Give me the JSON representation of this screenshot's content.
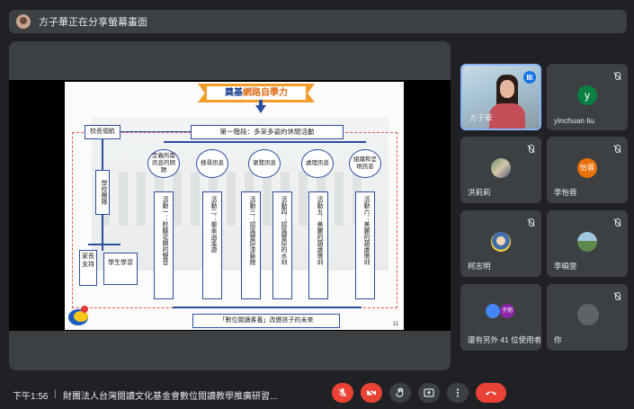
{
  "banner": {
    "text": "方子華正在分享螢幕畫面"
  },
  "slide": {
    "title_a": "奠基",
    "title_b": "網路自學力",
    "stage": "第一階段：多采多姿的休閒活動",
    "nav": "校長領航",
    "school": "學校團隊",
    "parent": "家長支持",
    "student": "學生學習",
    "ellipses": [
      "定義所需訊息的問題",
      "搜尋訊息",
      "瀏覽訊息",
      "處理訊息",
      "組織和呈現訊息"
    ],
    "activities": [
      "活動一：聆聽花開的聲音",
      "活動二：單車逍遙遊",
      "活動三：認識豐原漆藝館",
      "活動四：認識豐原的水圳",
      "活動五：美麗的葫蘆墩圳",
      "活動六：美麗的葫蘆墩圳"
    ],
    "bottom": "「數位閱讀素養」改變孩子的未來",
    "page_number": "11"
  },
  "participants": [
    {
      "name": "方子華",
      "avatar_letter": "",
      "color": ""
    },
    {
      "name": "yinchuan liu",
      "avatar_letter": "y",
      "color": "#0b8043"
    },
    {
      "name": "洪莉莉",
      "avatar_letter": "",
      "color": ""
    },
    {
      "name": "李怡蓉",
      "avatar_letter": "怡蓉",
      "color": "#e8710a"
    },
    {
      "name": "柯志明",
      "avatar_letter": "",
      "color": ""
    },
    {
      "name": "李曉雯",
      "avatar_letter": "",
      "color": ""
    },
    {
      "name": "還有另外 41 位使用者",
      "avatar_letter": "子朋",
      "color": "#8e24aa"
    },
    {
      "name": "你",
      "avatar_letter": "",
      "color": ""
    }
  ],
  "bottom_bar": {
    "time": "下午1:56",
    "divider": "|",
    "meeting": "財團法人台灣閱讀文化基金會數位閱讀教學推廣研習..."
  },
  "colors": {
    "end_call": "#ea4335",
    "background": "#202124",
    "tile": "#3c4043",
    "accent": "#8ab4f8"
  }
}
